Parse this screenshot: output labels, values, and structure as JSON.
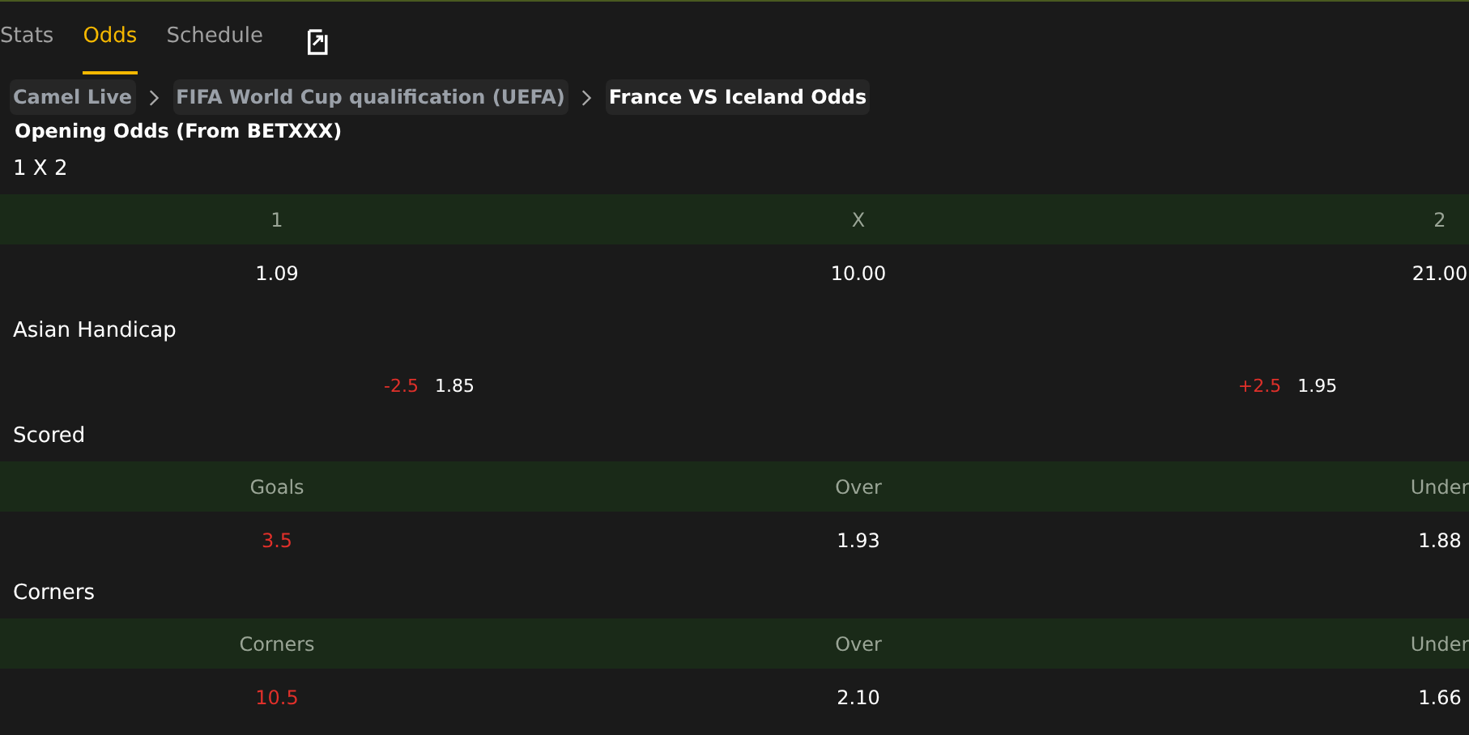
{
  "tabs": [
    {
      "label": "Stats",
      "selected": false
    },
    {
      "label": "Odds",
      "selected": true
    },
    {
      "label": "Schedule",
      "selected": false
    }
  ],
  "breadcrumbs": [
    {
      "label": "Camel Live",
      "current": false
    },
    {
      "label": "FIFA World Cup qualification (UEFA)",
      "current": false
    },
    {
      "label": "France VS Iceland Odds",
      "current": true
    }
  ],
  "subtitle": "Opening Odds (From BETXXX)",
  "sections": [
    {
      "kind": "table",
      "title": "1 X 2",
      "columns": [
        "1",
        "X",
        "2"
      ],
      "row": [
        {
          "text": "1.09",
          "line": false
        },
        {
          "text": "10.00",
          "line": false
        },
        {
          "text": "21.00",
          "line": false
        }
      ]
    },
    {
      "kind": "handicap",
      "title": "Asian Handicap",
      "sides": [
        {
          "line": "-2.5",
          "odds": "1.85"
        },
        {
          "line": "+2.5",
          "odds": "1.95"
        }
      ]
    },
    {
      "kind": "table",
      "title": "Scored",
      "columns": [
        "Goals",
        "Over",
        "Under"
      ],
      "row": [
        {
          "text": "3.5",
          "line": true
        },
        {
          "text": "1.93",
          "line": false
        },
        {
          "text": "1.88",
          "line": false
        }
      ]
    },
    {
      "kind": "table",
      "title": "Corners",
      "columns": [
        "Corners",
        "Over",
        "Under"
      ],
      "row": [
        {
          "text": "10.5",
          "line": true
        },
        {
          "text": "2.10",
          "line": false
        },
        {
          "text": "1.66",
          "line": false
        }
      ]
    }
  ]
}
